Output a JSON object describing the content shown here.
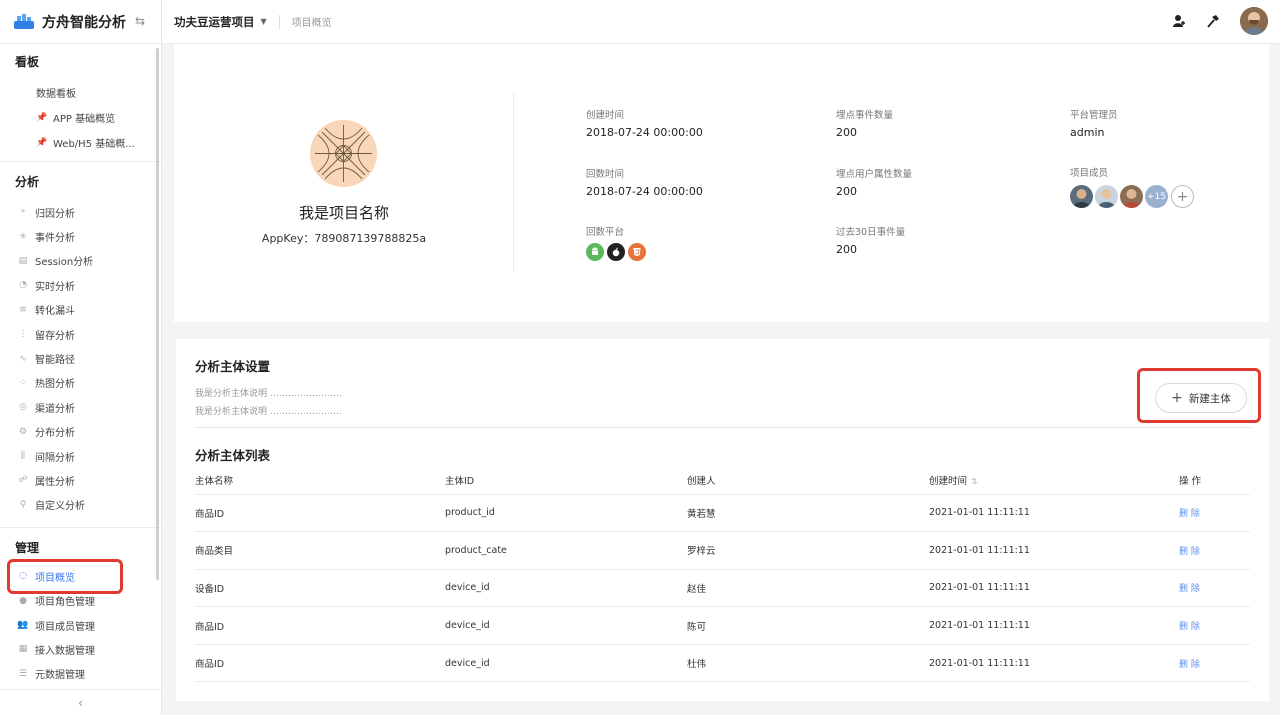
{
  "brand": {
    "name": "方舟智能分析"
  },
  "topbar": {
    "project_name": "功夫豆运营项目",
    "breadcrumb": "项目概览"
  },
  "sidebar": {
    "board": {
      "title": "看板",
      "items": [
        {
          "label": "数据看板"
        },
        {
          "label": "APP 基础概览"
        },
        {
          "label": "Web/H5 基础概..."
        }
      ]
    },
    "analysis": {
      "title": "分析",
      "items": [
        {
          "label": "归因分析"
        },
        {
          "label": "事件分析"
        },
        {
          "label": "Session分析"
        },
        {
          "label": "实时分析"
        },
        {
          "label": "转化漏斗"
        },
        {
          "label": "留存分析"
        },
        {
          "label": "智能路径"
        },
        {
          "label": "热图分析"
        },
        {
          "label": "渠道分析"
        },
        {
          "label": "分布分析"
        },
        {
          "label": "间隔分析"
        },
        {
          "label": "属性分析"
        },
        {
          "label": "自定义分析"
        }
      ]
    },
    "manage": {
      "title": "管理",
      "items": [
        {
          "label": "项目概览"
        },
        {
          "label": "项目角色管理"
        },
        {
          "label": "项目成员管理"
        },
        {
          "label": "接入数据管理"
        },
        {
          "label": "元数据管理"
        }
      ]
    }
  },
  "overview": {
    "project_title": "我是项目名称",
    "appkey": "AppKey：789087139788825a",
    "created_label": "创建时间",
    "created_value": "2018-07-24 00:00:00",
    "backfill_label": "回数时间",
    "backfill_value": "2018-07-24 00:00:00",
    "platform_label": "回数平台",
    "event_count_label": "埋点事件数量",
    "event_count_value": "200",
    "user_attr_label": "埋点用户属性数量",
    "user_attr_value": "200",
    "events30_label": "过去30日事件量",
    "events30_value": "200",
    "admin_label": "平台管理员",
    "admin_value": "admin",
    "members_label": "项目成员",
    "members_more": "+15"
  },
  "subject": {
    "settings_title": "分析主体设置",
    "desc1": "我是分析主体说明 ……………………",
    "desc2": "我是分析主体说明 ……………………",
    "new_button": "新建主体",
    "list_title": "分析主体列表",
    "columns": [
      "主体名称",
      "主体ID",
      "创建人",
      "创建时间",
      "操 作"
    ],
    "rows": [
      {
        "name": "商品ID",
        "id": "product_id",
        "creator": "黄若慧",
        "time": "2021-01-01  11:11:11",
        "op": "删 除"
      },
      {
        "name": "商品类目",
        "id": "product_cate",
        "creator": "罗梓云",
        "time": "2021-01-01  11:11:11",
        "op": "删 除"
      },
      {
        "name": "设备ID",
        "id": "device_id",
        "creator": "赵佳",
        "time": "2021-01-01  11:11:11",
        "op": "删 除"
      },
      {
        "name": "商品ID",
        "id": "device_id",
        "creator": "陈可",
        "time": "2021-01-01  11:11:11",
        "op": "删 除"
      },
      {
        "name": "商品ID",
        "id": "device_id",
        "creator": "杜伟",
        "time": "2021-01-01  11:11:11",
        "op": "删 除"
      }
    ]
  },
  "colors": {
    "accent": "#3a78f2",
    "highlight": "#e03a2f",
    "android": "#5cb85c",
    "apple": "#222222",
    "html5": "#e8733a"
  }
}
